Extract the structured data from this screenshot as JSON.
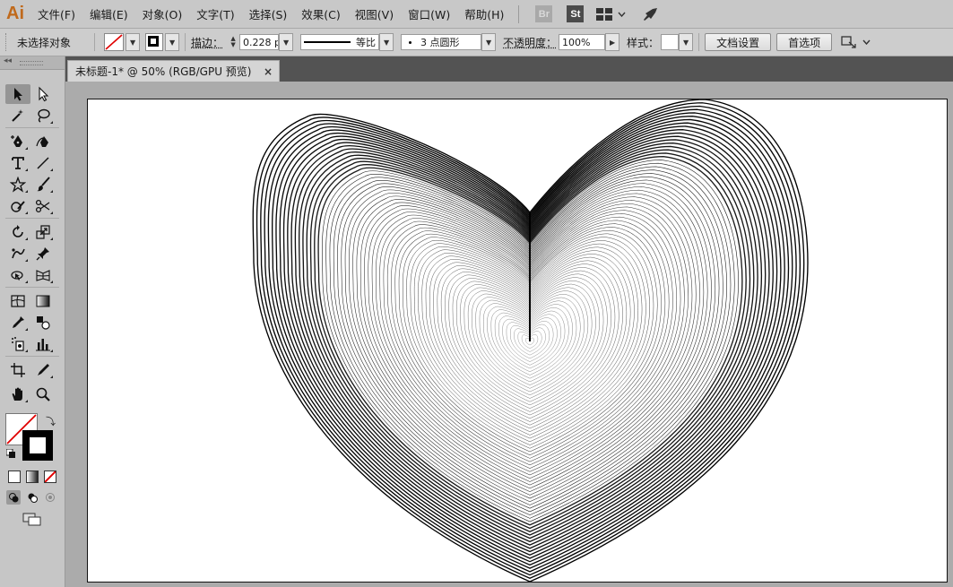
{
  "app": {
    "logo": "Ai",
    "menu": [
      "文件(F)",
      "编辑(E)",
      "对象(O)",
      "文字(T)",
      "选择(S)",
      "效果(C)",
      "视图(V)",
      "窗口(W)",
      "帮助(H)"
    ],
    "badges": {
      "bridge": "Br",
      "stock": "St"
    },
    "icons": [
      "workspace-grid-icon",
      "chevron-down-icon",
      "rocket-icon"
    ]
  },
  "control": {
    "selection_status": "未选择对象",
    "stroke_label": "描边：",
    "stroke_weight": "0.228 p",
    "profile_label": "等比",
    "brush_label": "3 点圆形",
    "opacity_label": "不透明度：",
    "opacity_value": "100%",
    "style_label": "样式：",
    "doc_setup": "文档设置",
    "preferences": "首选项"
  },
  "document": {
    "tab_title": "未标题-1* @ 50% (RGB/GPU 预览)",
    "close_glyph": "×"
  },
  "tools": [
    [
      "selection-tool-icon",
      "direct-selection-tool-icon"
    ],
    [
      "magic-wand-tool-icon",
      "lasso-tool-icon"
    ],
    [
      "pen-tool-icon",
      "curvature-tool-icon"
    ],
    [
      "type-tool-icon",
      "line-segment-tool-icon"
    ],
    [
      "star-tool-icon",
      "paintbrush-tool-icon"
    ],
    [
      "shaper-tool-icon",
      "scissors-tool-icon"
    ],
    [
      "rotate-tool-icon",
      "scale-tool-icon"
    ],
    [
      "puppet-warp-tool-icon",
      "pin-tool-icon"
    ],
    [
      "free-transform-tool-icon",
      "perspective-grid-tool-icon"
    ],
    [
      "mesh-tool-icon",
      "gradient-tool-icon"
    ],
    [
      "eyedropper-tool-icon",
      "blend-tool-icon"
    ],
    [
      "symbol-sprayer-tool-icon",
      "column-graph-tool-icon"
    ],
    [
      "artboard-tool-icon",
      "slice-tool-icon"
    ],
    [
      "hand-tool-icon",
      "zoom-tool-icon"
    ]
  ],
  "colors": {
    "app_bg": "#535353",
    "panel_bg": "#c6c6c6",
    "canvas_bg": "#ababab",
    "logo_orange": "#c06a1c",
    "none_red": "#e00000"
  }
}
